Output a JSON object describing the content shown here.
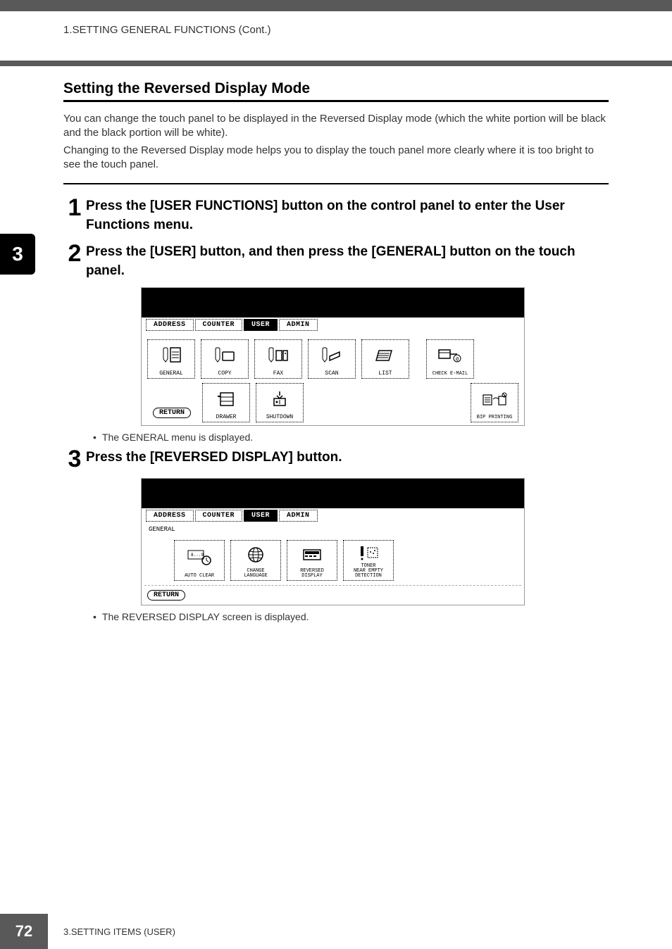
{
  "header": {
    "text": "1.SETTING GENERAL FUNCTIONS (Cont.)"
  },
  "sideTab": "3",
  "section": {
    "title": "Setting the Reversed Display Mode",
    "para1": "You can change the touch panel to be displayed in the Reversed Display mode (which the white portion will be black and the black portion will be white).",
    "para2": "Changing to the Reversed Display mode helps you to display the touch panel more clearly where it is too bright to see the touch panel."
  },
  "steps": {
    "s1": {
      "num": "1",
      "text": "Press the [USER FUNCTIONS] button on the control panel to enter the User Functions menu."
    },
    "s2": {
      "num": "2",
      "text": "Press the [USER] button, and then press the [GENERAL] button on the touch panel."
    },
    "s3": {
      "num": "3",
      "text": "Press the [REVERSED DISPLAY] button."
    }
  },
  "notes": {
    "n1": "The GENERAL menu is displayed.",
    "n2": "The REVERSED DISPLAY screen is displayed."
  },
  "screenshot1": {
    "tabs": {
      "address": "ADDRESS",
      "counter": "COUNTER",
      "user": "USER",
      "admin": "ADMIN"
    },
    "row1": {
      "general": "GENERAL",
      "copy": "COPY",
      "fax": "FAX",
      "scan": "SCAN",
      "list": "LIST",
      "checkEmail": "CHECK E-MAIL"
    },
    "row2": {
      "drawer": "DRAWER",
      "shutdown": "SHUTDOWN",
      "bipPrinting": "BIP PRINTING"
    },
    "return": "RETURN"
  },
  "screenshot2": {
    "tabs": {
      "address": "ADDRESS",
      "counter": "COUNTER",
      "user": "USER",
      "admin": "ADMIN"
    },
    "generalLabel": "GENERAL",
    "row1": {
      "autoClear": "AUTO CLEAR",
      "changeLanguage": "CHANGE\nLANGUAGE",
      "reversedDisplay": "REVERSED\nDISPLAY",
      "tonerDetection": "TONER\nNEAR EMPTY\nDETECTION"
    },
    "return": "RETURN"
  },
  "footer": {
    "pageNum": "72",
    "text": "3.SETTING ITEMS (USER)"
  }
}
